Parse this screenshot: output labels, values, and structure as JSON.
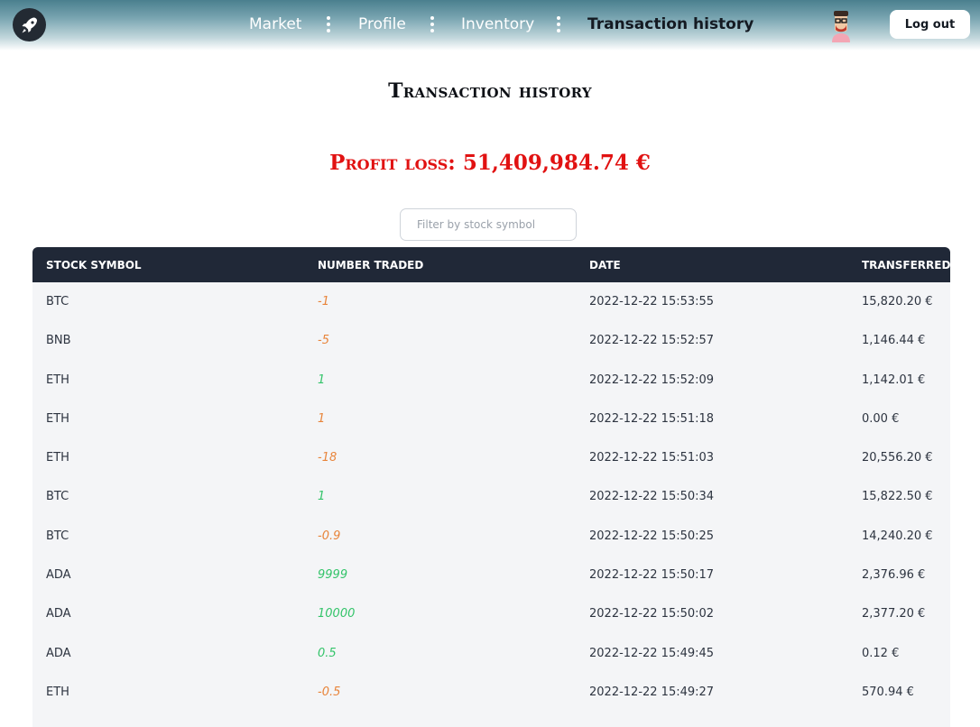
{
  "nav": {
    "links": [
      "Market",
      "Profile",
      "Inventory",
      "Transaction history"
    ],
    "logout_label": "Log out"
  },
  "page": {
    "title": "Transaction history",
    "profit_label": "Profit loss:",
    "profit_value": "51,409,984.74 €"
  },
  "filter": {
    "placeholder": "Filter by stock symbol",
    "value": ""
  },
  "table": {
    "headers": [
      "Stock symbol",
      "Number traded",
      "Date",
      "Transferred"
    ],
    "rows": [
      {
        "symbol": "BTC",
        "number": "-1",
        "trend": "neg",
        "date": "2022-12-22 15:53:55",
        "transferred": "15,820.20 €"
      },
      {
        "symbol": "BNB",
        "number": "-5",
        "trend": "neg",
        "date": "2022-12-22 15:52:57",
        "transferred": "1,146.44 €"
      },
      {
        "symbol": "ETH",
        "number": "1",
        "trend": "pos",
        "date": "2022-12-22 15:52:09",
        "transferred": "1,142.01 €"
      },
      {
        "symbol": "ETH",
        "number": "1",
        "trend": "neg",
        "date": "2022-12-22 15:51:18",
        "transferred": "0.00 €"
      },
      {
        "symbol": "ETH",
        "number": "-18",
        "trend": "neg",
        "date": "2022-12-22 15:51:03",
        "transferred": "20,556.20 €"
      },
      {
        "symbol": "BTC",
        "number": "1",
        "trend": "pos",
        "date": "2022-12-22 15:50:34",
        "transferred": "15,822.50 €"
      },
      {
        "symbol": "BTC",
        "number": "-0.9",
        "trend": "neg",
        "date": "2022-12-22 15:50:25",
        "transferred": "14,240.20 €"
      },
      {
        "symbol": "ADA",
        "number": "9999",
        "trend": "pos",
        "date": "2022-12-22 15:50:17",
        "transferred": "2,376.96 €"
      },
      {
        "symbol": "ADA",
        "number": "10000",
        "trend": "pos",
        "date": "2022-12-22 15:50:02",
        "transferred": "2,377.20 €"
      },
      {
        "symbol": "ADA",
        "number": "0.5",
        "trend": "pos",
        "date": "2022-12-22 15:49:45",
        "transferred": "0.12 €"
      },
      {
        "symbol": "ETH",
        "number": "-0.5",
        "trend": "neg",
        "date": "2022-12-22 15:49:27",
        "transferred": "570.94 €"
      }
    ]
  },
  "colors": {
    "profit": "#e11212",
    "table_header": "#202837",
    "negative": "#e8843a",
    "positive": "#34c46a"
  },
  "icons": [
    "rocket-icon",
    "avatar-icon"
  ]
}
